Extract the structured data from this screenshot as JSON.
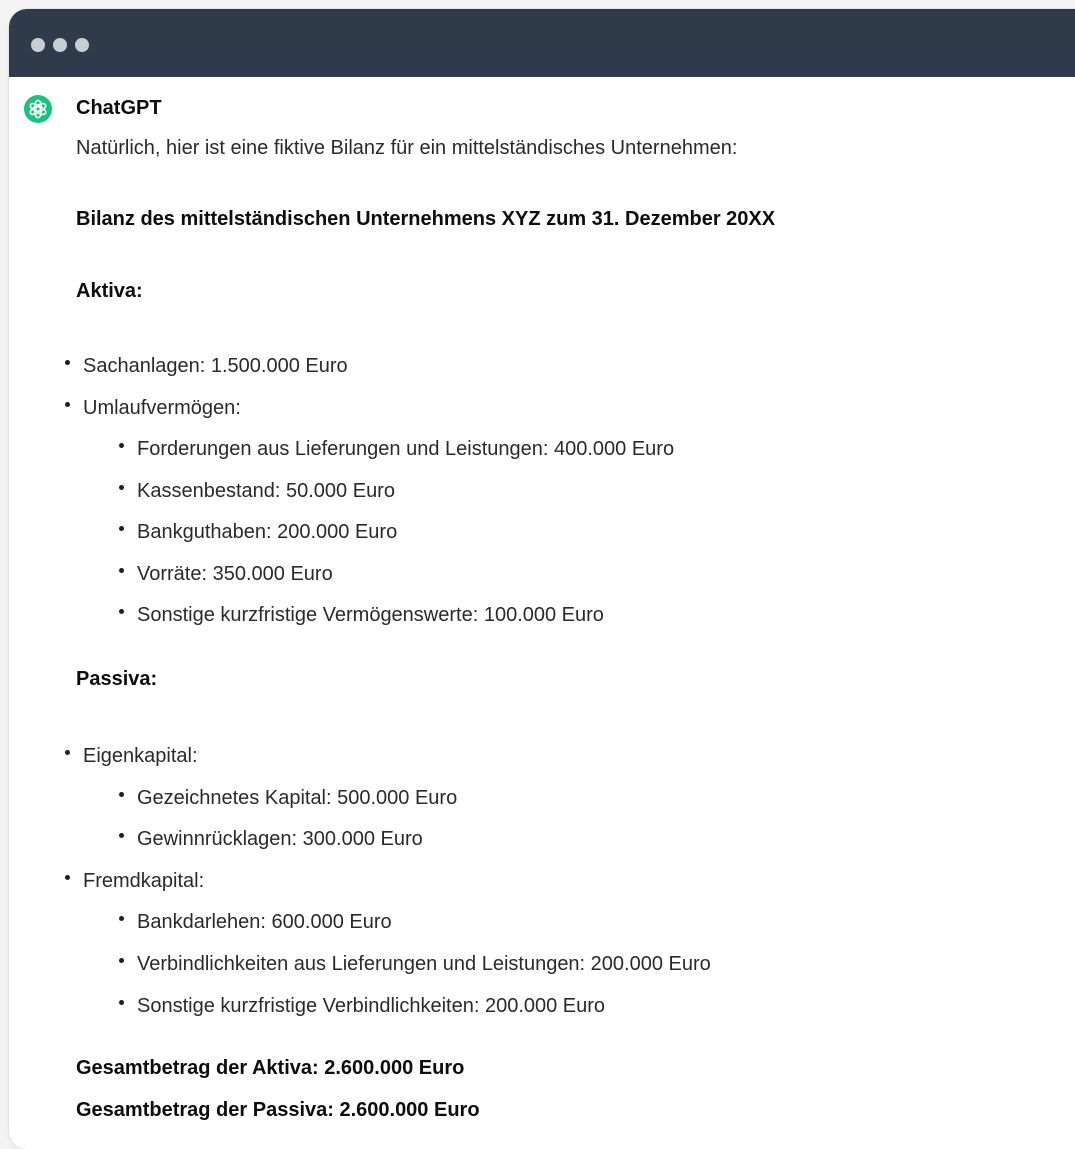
{
  "window": {
    "titlebar_color": "#2f3a4b",
    "avatar_color": "#19c37d"
  },
  "message": {
    "sender": "ChatGPT",
    "intro": "Natürlich, hier ist eine fiktive Bilanz für ein mittelständisches Unternehmen:",
    "title": "Bilanz des mittelständischen Unternehmens XYZ zum 31. Dezember 20XX",
    "aktiva_heading": "Aktiva:",
    "aktiva": {
      "sachanlagen": "Sachanlagen: 1.500.000 Euro",
      "umlauf": "Umlaufvermögen:",
      "umlauf_items": [
        "Forderungen aus Lieferungen und Leistungen: 400.000 Euro",
        "Kassenbestand: 50.000 Euro",
        "Bankguthaben: 200.000 Euro",
        "Vorräte: 350.000 Euro",
        "Sonstige kurzfristige Vermögenswerte: 100.000 Euro"
      ]
    },
    "passiva_heading": "Passiva:",
    "passiva": {
      "eigenkapital": "Eigenkapital:",
      "eigenkapital_items": [
        "Gezeichnetes Kapital: 500.000 Euro",
        "Gewinnrücklagen: 300.000 Euro"
      ],
      "fremdkapital": "Fremdkapital:",
      "fremdkapital_items": [
        "Bankdarlehen: 600.000 Euro",
        "Verbindlichkeiten aus Lieferungen und Leistungen: 200.000 Euro",
        "Sonstige kurzfristige Verbindlichkeiten: 200.000 Euro"
      ]
    },
    "total_aktiva": "Gesamtbetrag der Aktiva: 2.600.000 Euro",
    "total_passiva": "Gesamtbetrag der Passiva: 2.600.000 Euro"
  }
}
